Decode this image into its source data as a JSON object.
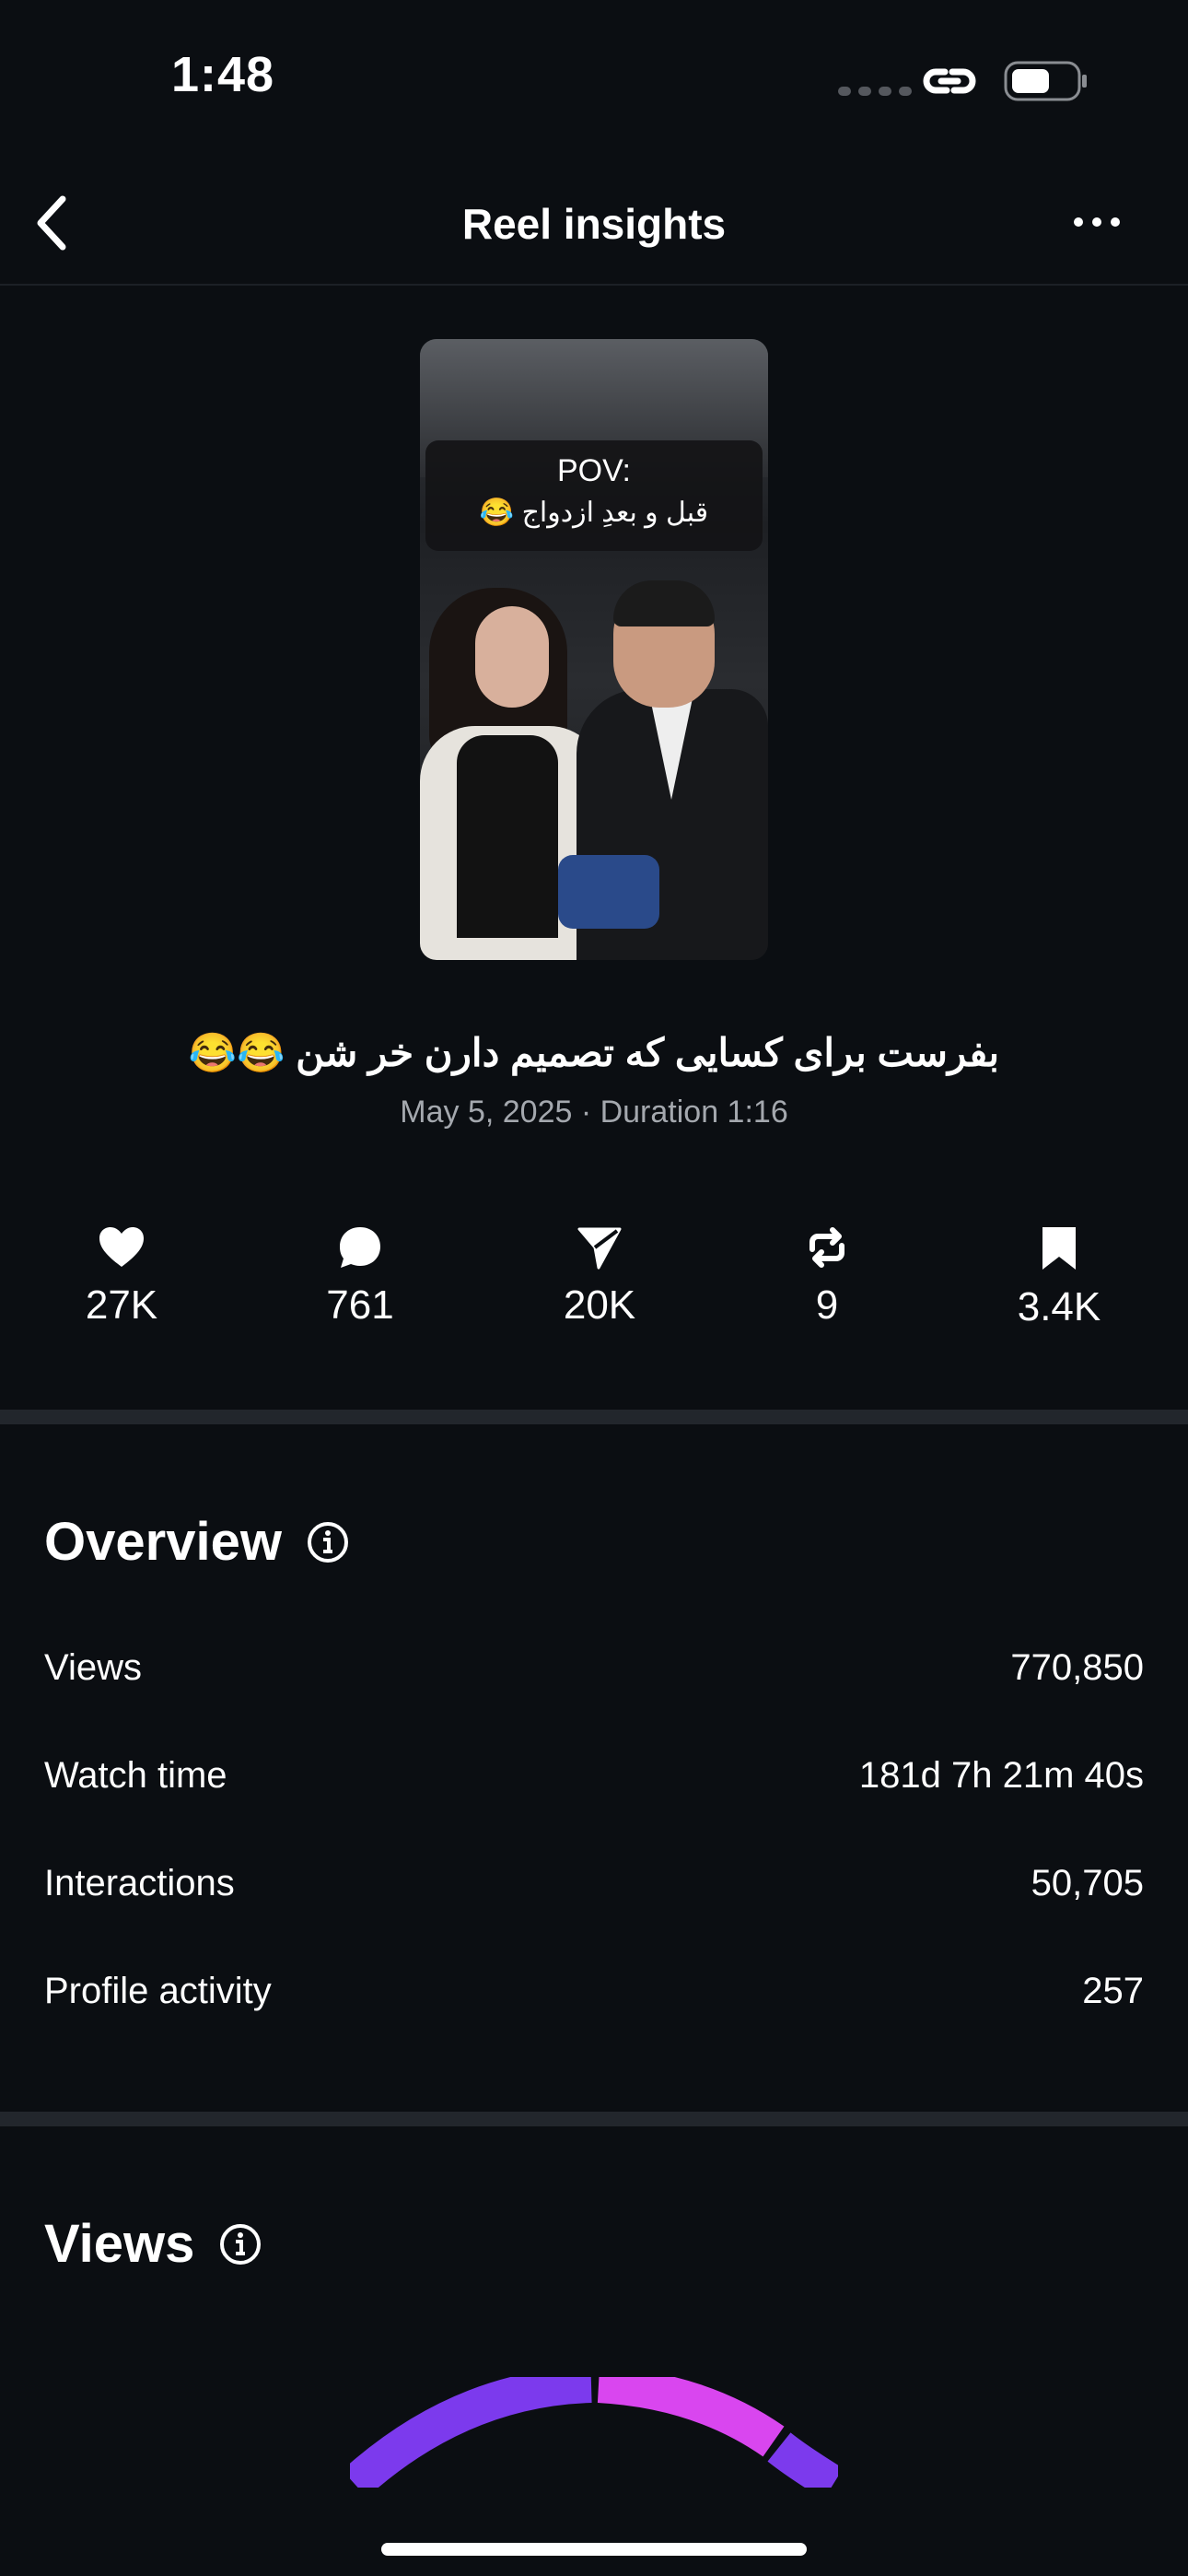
{
  "status_bar": {
    "time": "1:48"
  },
  "nav": {
    "title": "Reel insights"
  },
  "thumbnail": {
    "caption_line1": "POV:",
    "caption_line2": "قبل و بعدِ ازدواج 😂"
  },
  "reel": {
    "caption": "بفرست برای کسایی که تصمیم دارن خر شن 😂😂",
    "meta": "May 5, 2025 · Duration 1:16"
  },
  "stats": {
    "likes": "27K",
    "comments": "761",
    "shares": "20K",
    "reposts": "9",
    "saves": "3.4K"
  },
  "overview": {
    "title": "Overview",
    "rows": [
      {
        "label": "Views",
        "value": "770,850"
      },
      {
        "label": "Watch time",
        "value": "181d 7h 21m 40s"
      },
      {
        "label": "Interactions",
        "value": "50,705"
      },
      {
        "label": "Profile activity",
        "value": "257"
      }
    ]
  },
  "views_section": {
    "title": "Views"
  },
  "colors": {
    "background": "#0b0e12",
    "gauge_purple": "#7c3aed",
    "gauge_magenta": "#d946ef"
  }
}
